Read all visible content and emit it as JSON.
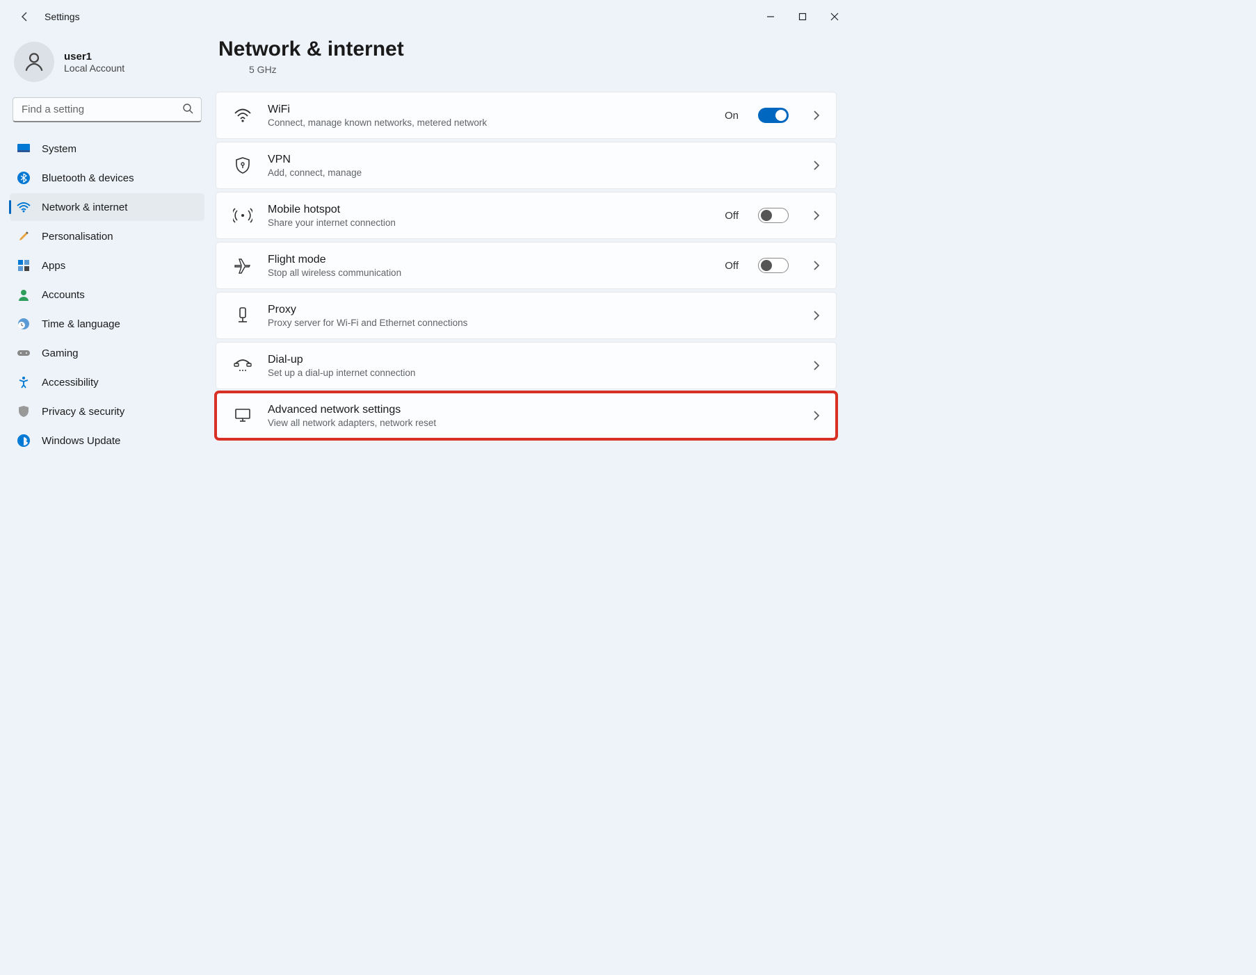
{
  "app": {
    "title": "Settings"
  },
  "user": {
    "name": "user1",
    "sub": "Local Account"
  },
  "search": {
    "placeholder": "Find a setting"
  },
  "sidebar": {
    "items": [
      {
        "label": "System"
      },
      {
        "label": "Bluetooth & devices"
      },
      {
        "label": "Network & internet"
      },
      {
        "label": "Personalisation"
      },
      {
        "label": "Apps"
      },
      {
        "label": "Accounts"
      },
      {
        "label": "Time & language"
      },
      {
        "label": "Gaming"
      },
      {
        "label": "Accessibility"
      },
      {
        "label": "Privacy & security"
      },
      {
        "label": "Windows Update"
      }
    ]
  },
  "page": {
    "title": "Network & internet",
    "subtitle": "5 GHz"
  },
  "cards": {
    "wifi": {
      "title": "WiFi",
      "sub": "Connect, manage known networks, metered network",
      "state": "On"
    },
    "vpn": {
      "title": "VPN",
      "sub": "Add, connect, manage"
    },
    "hotspot": {
      "title": "Mobile hotspot",
      "sub": "Share your internet connection",
      "state": "Off"
    },
    "flight": {
      "title": "Flight mode",
      "sub": "Stop all wireless communication",
      "state": "Off"
    },
    "proxy": {
      "title": "Proxy",
      "sub": "Proxy server for Wi-Fi and Ethernet connections"
    },
    "dialup": {
      "title": "Dial-up",
      "sub": "Set up a dial-up internet connection"
    },
    "advanced": {
      "title": "Advanced network settings",
      "sub": "View all network adapters, network reset"
    }
  }
}
